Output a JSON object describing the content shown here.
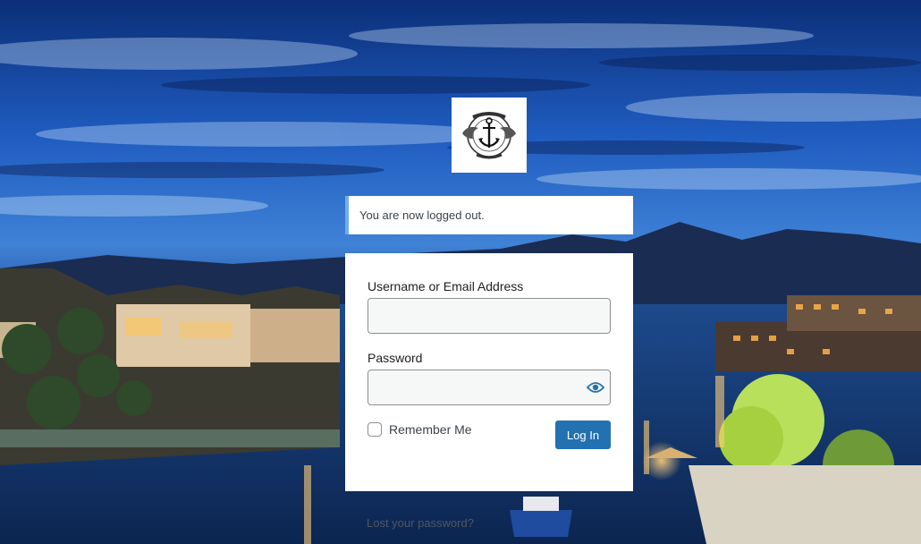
{
  "notice": {
    "message": "You are now logged out.",
    "accent_color": "#72aee6"
  },
  "logo": {
    "icon": "anchor-wings-emblem-icon",
    "emblem_text": "HAVASU WEB DESIGN"
  },
  "form": {
    "username_label": "Username or Email Address",
    "username_value": "",
    "password_label": "Password",
    "password_value": "",
    "show_password_icon": "eye-icon",
    "remember_label": "Remember Me",
    "remember_checked": false,
    "submit_label": "Log In",
    "button_color": "#2271b1"
  },
  "links": {
    "lost_password": "Lost your password?"
  }
}
